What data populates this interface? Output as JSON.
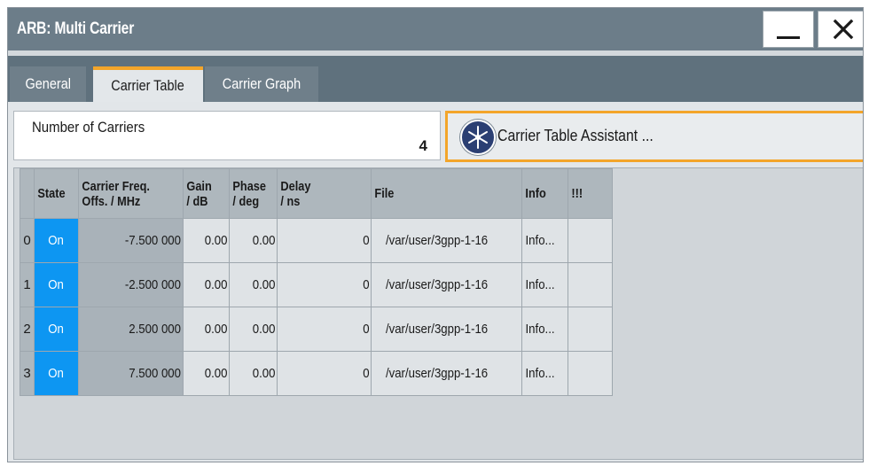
{
  "window": {
    "title": "ARB: Multi Carrier",
    "minimize_icon": "minimize-icon",
    "close_icon": "close-icon"
  },
  "tabs": [
    {
      "label": "General"
    },
    {
      "label": "Carrier Table"
    },
    {
      "label": "Carrier Graph"
    }
  ],
  "accent_color": "#f3a52a",
  "state_color": "#0d96f2",
  "carriers": {
    "label": "Number of Carriers",
    "value": "4"
  },
  "assistant": {
    "label": "Carrier Table Assistant ...",
    "icon": "star-burst-icon"
  },
  "table": {
    "headers": {
      "state": "State",
      "freq_1": "Carrier Freq.",
      "freq_2": "Offs. / MHz",
      "gain_1": "Gain",
      "gain_2": "/ dB",
      "phase_1": "Phase",
      "phase_2": "/ deg",
      "delay_1": "Delay",
      "delay_2": "/ ns",
      "file": "File",
      "info": "Info",
      "warn": "!!!"
    },
    "rows": [
      {
        "index": "0",
        "state": "On",
        "freq": "-7.500 000",
        "gain": "0.00",
        "phase": "0.00",
        "delay": "0",
        "file": "/var/user/3gpp-1-16",
        "info": "Info..."
      },
      {
        "index": "1",
        "state": "On",
        "freq": "-2.500 000",
        "gain": "0.00",
        "phase": "0.00",
        "delay": "0",
        "file": "/var/user/3gpp-1-16",
        "info": "Info..."
      },
      {
        "index": "2",
        "state": "On",
        "freq": "2.500 000",
        "gain": "0.00",
        "phase": "0.00",
        "delay": "0",
        "file": "/var/user/3gpp-1-16",
        "info": "Info..."
      },
      {
        "index": "3",
        "state": "On",
        "freq": "7.500 000",
        "gain": "0.00",
        "phase": "0.00",
        "delay": "0",
        "file": "/var/user/3gpp-1-16",
        "info": "Info..."
      }
    ]
  }
}
